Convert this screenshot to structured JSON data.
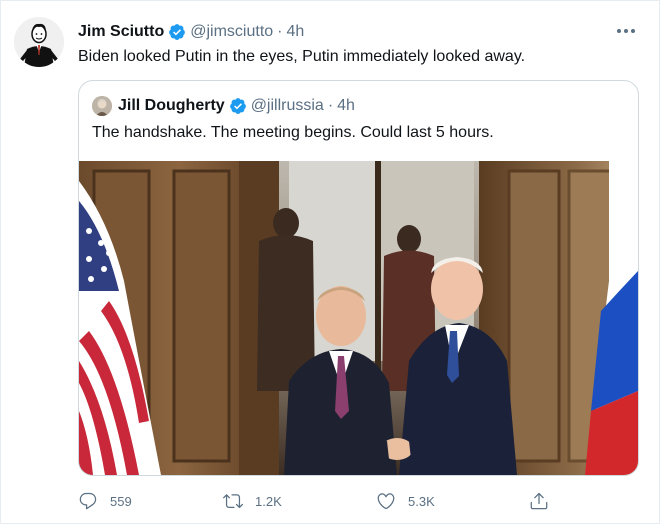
{
  "tweet": {
    "author_name": "Jim Sciutto",
    "handle": "@jimsciutto",
    "separator": "·",
    "time": "4h",
    "text": "Biden looked Putin in the eyes, Putin immediately looked away.",
    "more_icon": "more-horizontal-icon"
  },
  "quoted_tweet": {
    "author_name": "Jill Dougherty",
    "handle": "@jillrussia",
    "separator": "·",
    "time": "4h",
    "text": "The handshake. The meeting begins. Could last 5 hours."
  },
  "actions": {
    "reply_count": "559",
    "retweet_count": "1.2K",
    "like_count": "5.3K"
  },
  "colors": {
    "verified_blue": "#1d9bf0",
    "secondary_text": "#5b7083",
    "border": "#cfd9de"
  }
}
